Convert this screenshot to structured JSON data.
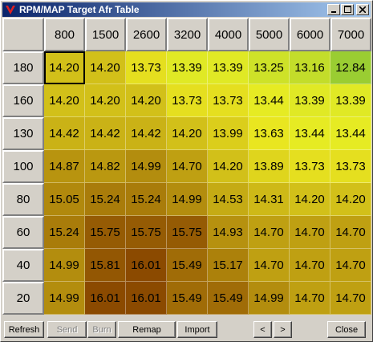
{
  "window": {
    "title": "RPM/MAP Target Afr Table",
    "app_icon": "red-v-logo-icon",
    "controls": [
      "minimize-icon",
      "maximize-icon",
      "close-icon"
    ]
  },
  "table": {
    "rpm": [
      "800",
      "1500",
      "2600",
      "3200",
      "4000",
      "5000",
      "6000",
      "7000"
    ],
    "map": [
      "180",
      "160",
      "130",
      "100",
      "80",
      "60",
      "40",
      "20"
    ],
    "values": [
      [
        "14.20",
        "14.20",
        "13.73",
        "13.39",
        "13.39",
        "13.25",
        "13.16",
        "12.84"
      ],
      [
        "14.20",
        "14.20",
        "14.20",
        "13.73",
        "13.73",
        "13.44",
        "13.39",
        "13.39"
      ],
      [
        "14.42",
        "14.42",
        "14.42",
        "14.20",
        "13.99",
        "13.63",
        "13.44",
        "13.44"
      ],
      [
        "14.87",
        "14.82",
        "14.99",
        "14.70",
        "14.20",
        "13.89",
        "13.73",
        "13.73"
      ],
      [
        "15.05",
        "15.24",
        "15.24",
        "14.99",
        "14.53",
        "14.31",
        "14.20",
        "14.20"
      ],
      [
        "15.24",
        "15.75",
        "15.75",
        "15.75",
        "14.93",
        "14.70",
        "14.70",
        "14.70"
      ],
      [
        "14.99",
        "15.81",
        "16.01",
        "15.49",
        "15.17",
        "14.70",
        "14.70",
        "14.70"
      ],
      [
        "14.99",
        "16.01",
        "16.01",
        "15.49",
        "15.49",
        "14.99",
        "14.70",
        "14.70"
      ]
    ],
    "selected_cell": {
      "row": 0,
      "col": 0
    },
    "color_scale": {
      "low": "#9acd32",
      "mid": "#eeee22",
      "high": "#8b4a00"
    }
  },
  "buttons": {
    "refresh": "Refresh",
    "send": "Send",
    "burn": "Burn",
    "remap": "Remap",
    "import": "Import",
    "prev": "<",
    "next": ">",
    "close": "Close"
  }
}
